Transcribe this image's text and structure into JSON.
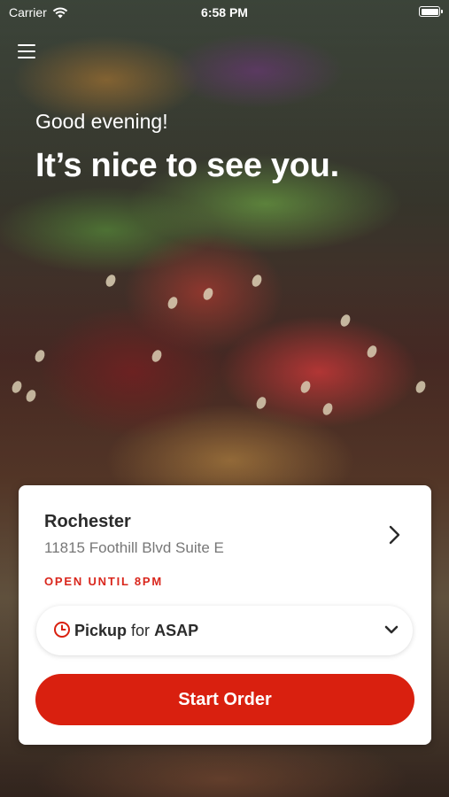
{
  "status_bar": {
    "carrier": "Carrier",
    "time": "6:58 PM",
    "battery_level": 1.0
  },
  "header": {
    "greeting": "Good evening!",
    "headline": "It’s nice to see you."
  },
  "location": {
    "name": "Rochester",
    "address": "11815 Foothill Blvd Suite E",
    "hours": "OPEN UNTIL 8PM"
  },
  "order_mode": {
    "mode": "Pickup",
    "connector": "for",
    "time": "ASAP"
  },
  "actions": {
    "start_order": "Start Order"
  },
  "colors": {
    "accent": "#d9200f",
    "text_dark": "#2b2b2b",
    "text_muted": "#777777"
  },
  "icons": {
    "menu": "hamburger-menu-icon",
    "wifi": "wifi-icon",
    "battery": "battery-icon",
    "clock": "clock-icon",
    "chevron_right": "chevron-right-icon",
    "chevron_down": "chevron-down-icon"
  }
}
